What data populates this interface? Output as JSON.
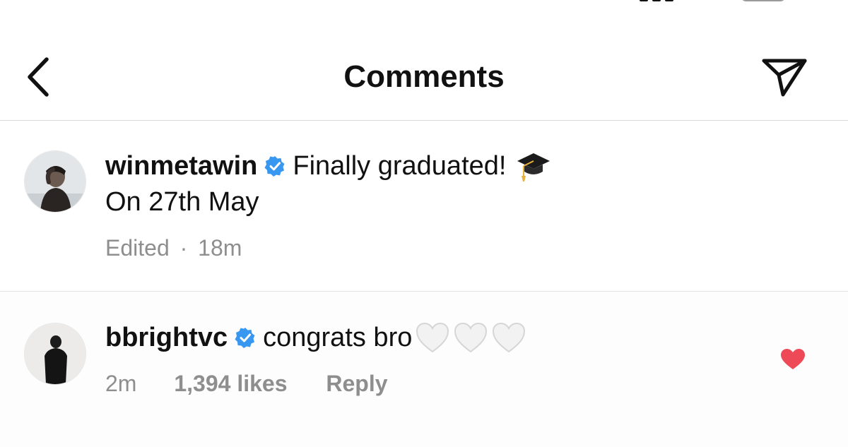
{
  "header": {
    "title": "Comments"
  },
  "caption": {
    "username": "winmetawin",
    "text": "Finally graduated!",
    "text_line2": "On 27th May",
    "edited_label": "Edited",
    "separator": "·",
    "time": "18m",
    "emoji_icon": "graduation-cap-icon"
  },
  "comment": {
    "username": "bbrightvc",
    "text": "congrats bro",
    "hearts_count": 3,
    "time": "2m",
    "likes": "1,394 likes",
    "reply_label": "Reply",
    "liked": true
  },
  "colors": {
    "verified": "#3897f0",
    "like_red": "#ed4956",
    "meta_gray": "#8e8e8e",
    "divider": "#dcdcdc"
  }
}
